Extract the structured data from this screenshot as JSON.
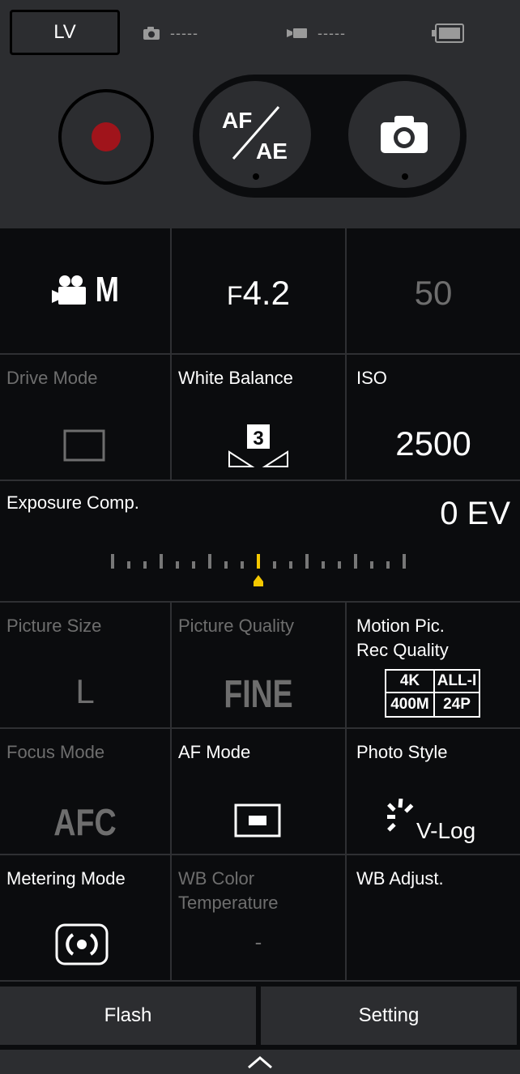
{
  "top_bar": {
    "lv_label": "LV",
    "photo_remaining": "-----",
    "video_remaining": "-----",
    "battery_icon": "battery-full-icon"
  },
  "shutter_controls": {
    "record_color": "#a0141b",
    "af_ae_top": "AF",
    "af_ae_bottom": "AE"
  },
  "exposure": {
    "mode_letter": "M",
    "aperture_prefix": "F",
    "aperture_value": "4.2",
    "shutter_speed": "50"
  },
  "settings": {
    "drive_mode": {
      "label": "Drive Mode"
    },
    "white_balance": {
      "label": "White Balance",
      "value": "3"
    },
    "iso": {
      "label": "ISO",
      "value": "2500"
    },
    "exposure_comp": {
      "label": "Exposure Comp.",
      "value": "0 EV",
      "level": 0,
      "accent": "#f5c800"
    },
    "picture_size": {
      "label": "Picture Size",
      "value": "L"
    },
    "picture_quality": {
      "label": "Picture Quality",
      "value": "FINE"
    },
    "motion_rec_quality": {
      "label_line1": "Motion Pic.",
      "label_line2": "Rec Quality",
      "res": "4K",
      "codec": "ALL-I",
      "bitrate": "400M",
      "fps": "24P"
    },
    "focus_mode": {
      "label": "Focus Mode",
      "value": "AFC"
    },
    "af_mode": {
      "label": "AF Mode"
    },
    "photo_style": {
      "label": "Photo Style",
      "value": "V-Log"
    },
    "metering_mode": {
      "label": "Metering Mode"
    },
    "wb_color_temp": {
      "label_line1": "WB Color",
      "label_line2": "Temperature",
      "value": "-"
    },
    "wb_adjust": {
      "label": "WB Adjust."
    }
  },
  "bottom": {
    "flash_label": "Flash",
    "setting_label": "Setting"
  }
}
